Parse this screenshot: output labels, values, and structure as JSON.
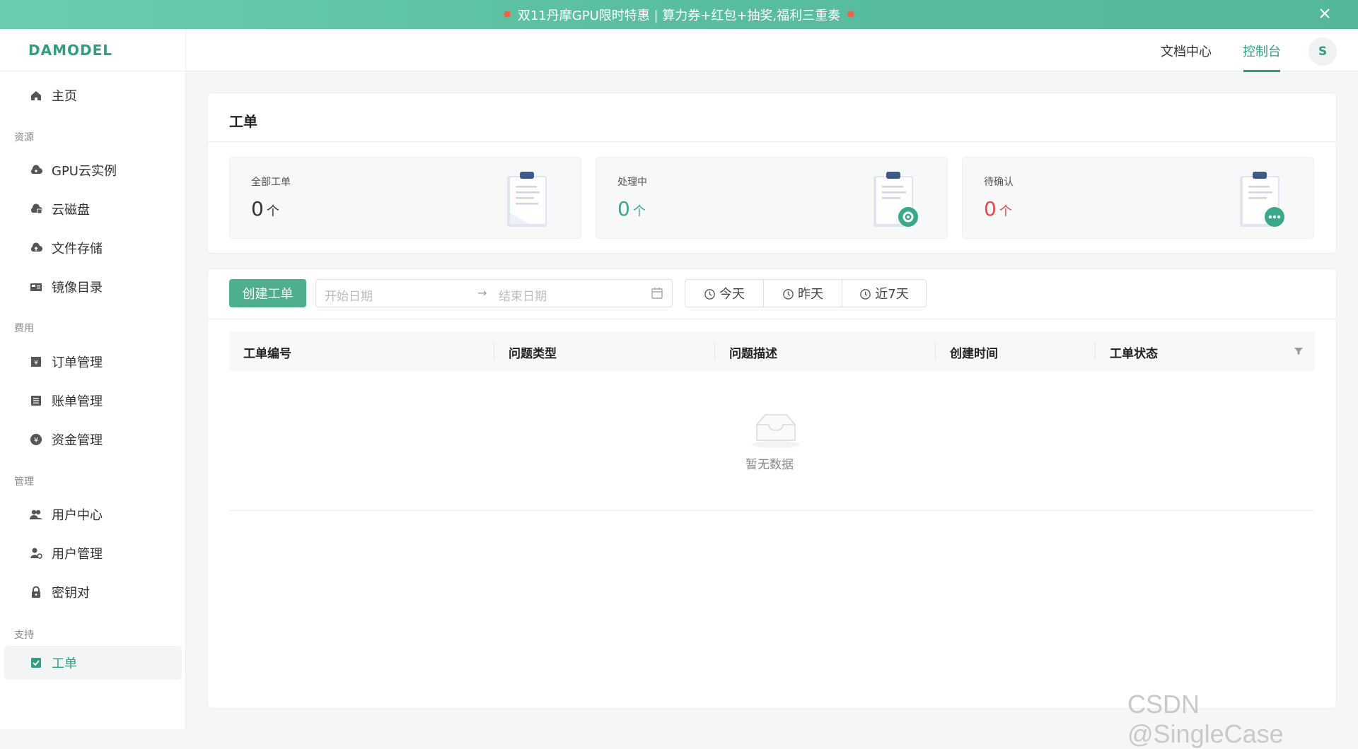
{
  "banner": {
    "text": "双11丹摩GPU限时特惠 | 算力券+红包+抽奖,福利三重奏",
    "spark_left": "✸",
    "spark_right": "✸"
  },
  "sidebar": {
    "logo": "DAMODEL",
    "home": "主页",
    "groups": {
      "resources": "资源",
      "fees": "费用",
      "management": "管理",
      "support": "支持"
    },
    "items": {
      "gpu": "GPU云实例",
      "disk": "云磁盘",
      "storage": "文件存储",
      "images": "镜像目录",
      "orders": "订单管理",
      "bills": "账单管理",
      "funds": "资金管理",
      "user_center": "用户中心",
      "user_manage": "用户管理",
      "keys": "密钥对",
      "tickets": "工单"
    }
  },
  "topbar": {
    "docs": "文档中心",
    "console": "控制台",
    "avatar": "S"
  },
  "summary": {
    "title": "工单",
    "stats": [
      {
        "label": "全部工单",
        "value": "0",
        "unit": "个"
      },
      {
        "label": "处理中",
        "value": "0",
        "unit": "个"
      },
      {
        "label": "待确认",
        "value": "0",
        "unit": "个"
      }
    ]
  },
  "toolbar": {
    "create_label": "创建工单",
    "start_placeholder": "开始日期",
    "arrow": "→",
    "end_placeholder": "结束日期",
    "today": "今天",
    "yesterday": "昨天",
    "last7": "近7天"
  },
  "table": {
    "columns": [
      "工单编号",
      "问题类型",
      "问题描述",
      "创建时间",
      "工单状态"
    ],
    "empty_text": "暂无数据"
  },
  "watermark": "CSDN @SingleCase",
  "colors": {
    "accent": "#2f9f7f",
    "button": "#4eae8d",
    "danger": "#e84a4a"
  }
}
